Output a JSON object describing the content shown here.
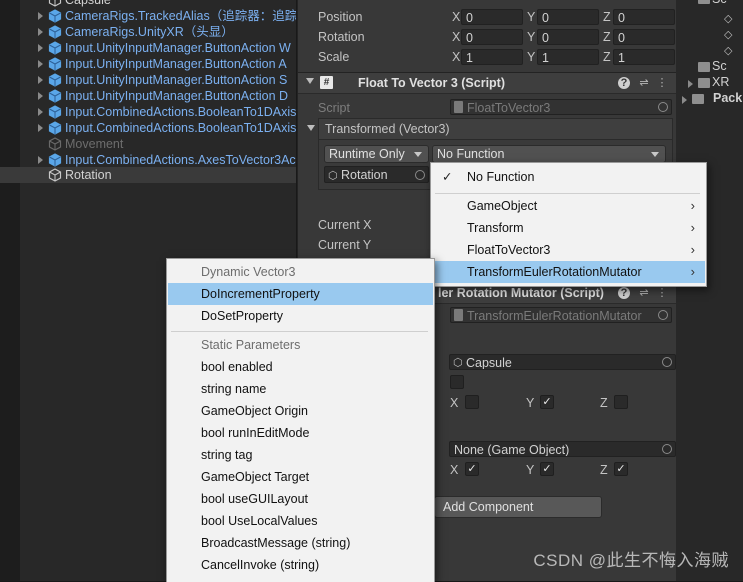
{
  "hierarchy": {
    "rows": [
      {
        "label": "Capsule",
        "style": "plain"
      },
      {
        "label": "CameraRigs.TrackedAlias（追踪器：追踪",
        "style": "link"
      },
      {
        "label": "CameraRigs.UnityXR（头显）",
        "style": "link"
      },
      {
        "label": "Input.UnityInputManager.ButtonAction W",
        "style": "link"
      },
      {
        "label": "Input.UnityInputManager.ButtonAction A",
        "style": "link"
      },
      {
        "label": "Input.UnityInputManager.ButtonAction S",
        "style": "link"
      },
      {
        "label": "Input.UnityInputManager.ButtonAction D",
        "style": "link"
      },
      {
        "label": "Input.CombinedActions.BooleanTo1DAxis",
        "style": "link"
      },
      {
        "label": "Input.CombinedActions.BooleanTo1DAxis",
        "style": "link"
      },
      {
        "label": "Movement",
        "style": "dim"
      },
      {
        "label": "Input.CombinedActions.AxesToVector3Ac",
        "style": "link"
      },
      {
        "label": "Rotation",
        "style": "selected"
      }
    ]
  },
  "transform": {
    "position": {
      "label": "Position",
      "x": "0",
      "y": "0",
      "z": "0"
    },
    "rotation": {
      "label": "Rotation",
      "x": "0",
      "y": "0",
      "z": "0"
    },
    "scale": {
      "label": "Scale",
      "x": "1",
      "y": "1",
      "z": "1"
    },
    "axis_x": "X",
    "axis_y": "Y",
    "axis_z": "Z"
  },
  "float_to_vector3": {
    "title": "Float To Vector 3 (Script)",
    "script_label": "Script",
    "script_value": "FloatToVector3",
    "event_header": "Transformed (Vector3)",
    "runtime_value": "Runtime Only",
    "function_value": "No Function",
    "target_value": "Rotation",
    "current_x_label": "Current X",
    "current_y_label": "Current Y"
  },
  "mutator": {
    "title_fragment": "ler Rotation Mutator (Script)",
    "script_value": "TransformEulerRotationMutator",
    "target_value": "Capsule",
    "origin_value": "None (Game Object)",
    "axis_x": "X",
    "axis_y": "Y",
    "axis_z": "Z",
    "check_mark": "✓"
  },
  "add_component_label": "Add Component",
  "function_menu": {
    "items": [
      {
        "label": "No Function",
        "checked": true
      },
      {
        "label": "GameObject",
        "submenu": true
      },
      {
        "label": "Transform",
        "submenu": true
      },
      {
        "label": "FloatToVector3",
        "submenu": true
      },
      {
        "label": "TransformEulerRotationMutator",
        "submenu": true,
        "highlighted": true
      }
    ],
    "check_glyph": "✓",
    "submenu_glyph": "›"
  },
  "method_menu": {
    "dynamic_header": "Dynamic Vector3",
    "dynamic_items": [
      "DoIncrementProperty",
      "DoSetProperty"
    ],
    "static_header": "Static Parameters",
    "static_items": [
      "bool enabled",
      "string name",
      "GameObject Origin",
      "bool runInEditMode",
      "string tag",
      "GameObject Target",
      "bool useGUILayout",
      "bool UseLocalValues",
      "BroadcastMessage (string)",
      "CancelInvoke (string)"
    ]
  },
  "project": {
    "items": [
      "Sc",
      "XR",
      "Pack"
    ]
  },
  "watermark": "CSDN @此生不悔入海贼",
  "colors": {
    "link": "#7bb0f0",
    "menu_highlight": "#99c9ef",
    "inspector_bg": "#383838",
    "hierarchy_bg": "#282828"
  },
  "icons": {
    "cube": "cube-icon",
    "script_hash": "hash-icon",
    "help": "help-icon",
    "preset": "preset-icon",
    "more": "kebab-icon",
    "object_picker": "target-icon",
    "foldout": "foldout-arrow-icon",
    "folder": "folder-icon"
  }
}
